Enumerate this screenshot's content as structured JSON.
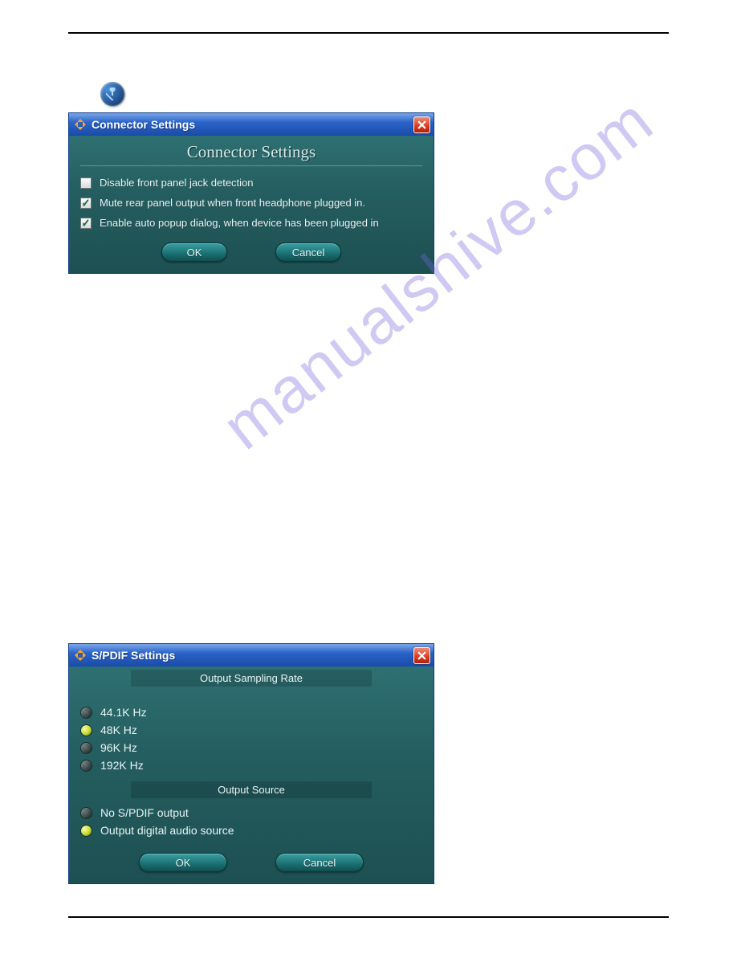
{
  "watermark": "manualshive.com",
  "dialog1": {
    "title": "Connector Settings",
    "heading": "Connector Settings",
    "options": [
      {
        "label": "Disable front panel jack detection",
        "checked": false
      },
      {
        "label": "Mute rear panel output when front headphone plugged in.",
        "checked": true
      },
      {
        "label": "Enable auto popup dialog, when device has been plugged in",
        "checked": true
      }
    ],
    "ok": "OK",
    "cancel": "Cancel"
  },
  "dialog2": {
    "title": "S/PDIF Settings",
    "section1": "Output Sampling Rate",
    "rates": [
      {
        "label": "44.1K Hz",
        "selected": false
      },
      {
        "label": "48K Hz",
        "selected": true
      },
      {
        "label": "96K Hz",
        "selected": false
      },
      {
        "label": "192K Hz",
        "selected": false
      }
    ],
    "section2": "Output Source",
    "sources": [
      {
        "label": "No S/PDIF output",
        "selected": false
      },
      {
        "label": "Output digital audio source",
        "selected": true
      }
    ],
    "ok": "OK",
    "cancel": "Cancel"
  }
}
